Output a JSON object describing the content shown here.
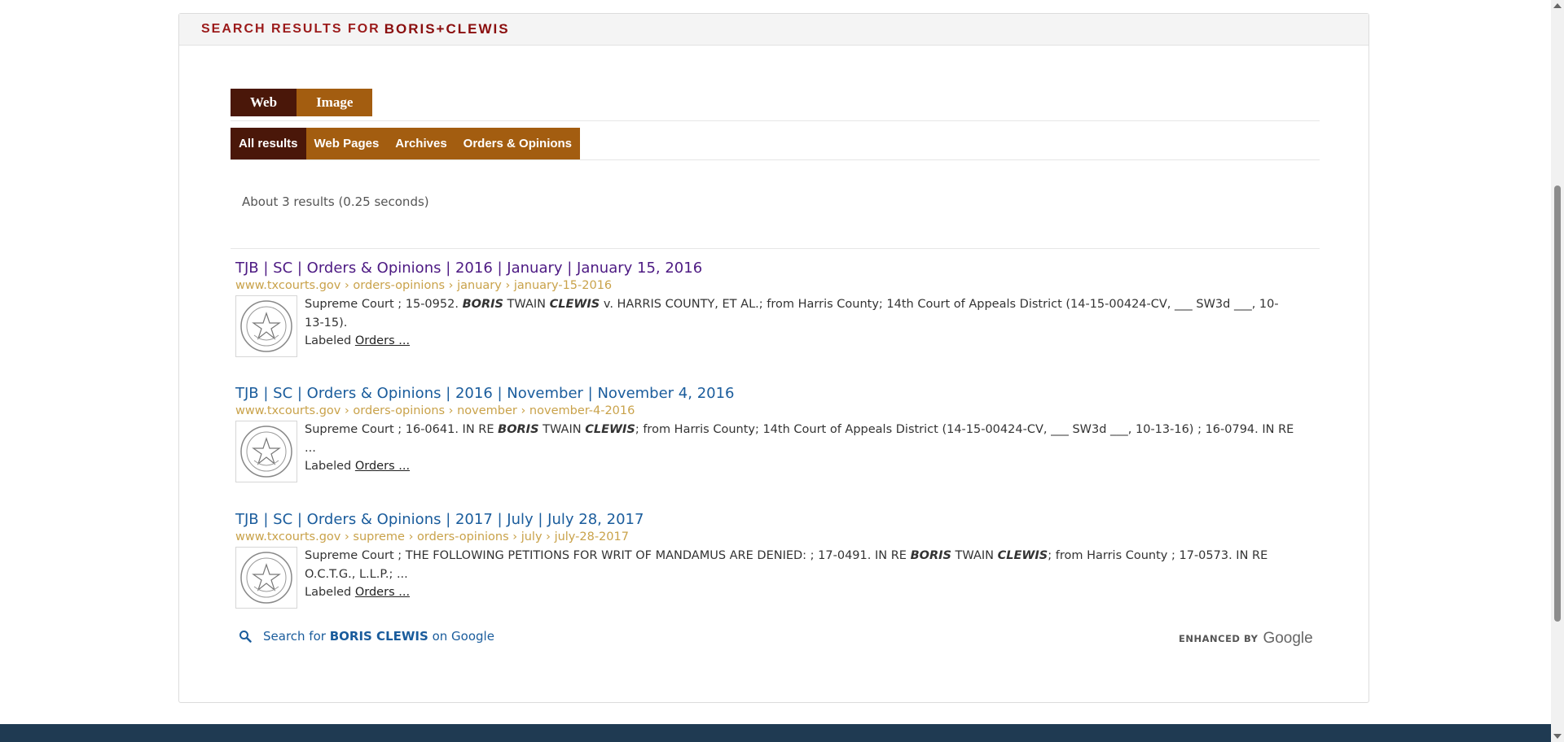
{
  "header": {
    "prefix": "SEARCH RESULTS FOR",
    "query": "BORIS+CLEWIS"
  },
  "tabs": [
    {
      "label": "Web",
      "active": true
    },
    {
      "label": "Image",
      "active": false
    }
  ],
  "subtabs": [
    {
      "label": "All results",
      "active": true
    },
    {
      "label": "Web Pages",
      "active": false
    },
    {
      "label": "Archives",
      "active": false
    },
    {
      "label": "Orders & Opinions",
      "active": false
    }
  ],
  "result_count": "About 3 results (0.25 seconds)",
  "results": [
    {
      "title": "TJB | SC | Orders & Opinions | 2016 | January | January 15, 2016",
      "visited": true,
      "url_domain": "www.txcourts.gov",
      "url_parts": [
        "orders-opinions",
        "january",
        "january-15-2016"
      ],
      "snippet_pre": "Supreme Court ; 15-0952. ",
      "snippet_b1": "BORIS",
      "snippet_mid": " TWAIN ",
      "snippet_b2": "CLEWIS",
      "snippet_post": " v. HARRIS COUNTY, ET AL.; from Harris County; 14th Court of Appeals District (14-15-00424-CV, ___ SW3d ___, 10-13-15).",
      "labeled_prefix": "Labeled",
      "labeled_link": "Orders ..."
    },
    {
      "title": "TJB | SC | Orders & Opinions | 2016 | November | November 4, 2016",
      "visited": false,
      "url_domain": "www.txcourts.gov",
      "url_parts": [
        "orders-opinions",
        "november",
        "november-4-2016"
      ],
      "snippet_pre": "Supreme Court ; 16-0641. IN RE ",
      "snippet_b1": "BORIS",
      "snippet_mid": " TWAIN ",
      "snippet_b2": "CLEWIS",
      "snippet_post": "; from Harris County; 14th Court of Appeals District (14-15-00424-CV, ___ SW3d ___, 10-13-16) ; 16-0794. IN RE ...",
      "labeled_prefix": "Labeled",
      "labeled_link": "Orders ..."
    },
    {
      "title": "TJB | SC | Orders & Opinions | 2017 | July | July 28, 2017",
      "visited": false,
      "url_domain": "www.txcourts.gov",
      "url_parts": [
        "supreme",
        "orders-opinions",
        "july",
        "july-28-2017"
      ],
      "snippet_pre": "Supreme Court ; THE FOLLOWING PETITIONS FOR WRIT OF MANDAMUS ARE DENIED: ; 17-0491. IN RE ",
      "snippet_b1": "BORIS",
      "snippet_mid": " TWAIN ",
      "snippet_b2": "CLEWIS",
      "snippet_post": "; from Harris County ; 17-0573. IN RE O.C.T.G., L.L.P.; ...",
      "labeled_prefix": "Labeled",
      "labeled_link": "Orders ..."
    }
  ],
  "google_search": {
    "prefix": "Search for",
    "term": "BORIS CLEWIS",
    "suffix": "on Google"
  },
  "enhanced_by": {
    "label": "ENHANCED BY",
    "brand": "Google"
  },
  "colors": {
    "accent_dark": "#4a1709",
    "accent": "#a35d10",
    "header_red": "#9b1a1a",
    "link": "#1a5c9c",
    "visited": "#4d1a83",
    "url": "#c9a24a"
  }
}
